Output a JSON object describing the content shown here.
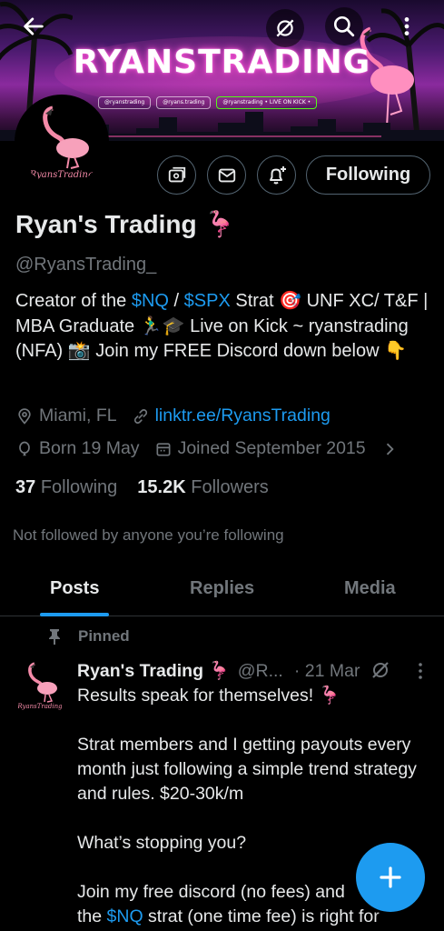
{
  "banner": {
    "brand_text": "RYANSTRADING",
    "socials": [
      "@ryanstrading",
      "@ryans.trading",
      "@ryanstrading • LIVE ON KICK •"
    ]
  },
  "profile": {
    "name": "Ryan's Trading",
    "name_emoji": "🦩",
    "handle": "@RyansTrading_",
    "bio": {
      "part1": "Creator of the ",
      "link1": "$NQ",
      "part2": " / ",
      "link2": "$SPX",
      "part3": " Strat 🎯 UNF XC/ T&F | MBA Graduate 🏃‍♂️🎓 Live on Kick ~ ryanstrading (NFA) 📸 Join my FREE Discord down below 👇"
    },
    "location": "Miami, FL",
    "website": "linktr.ee/RyansTrading",
    "born": "Born 19 May",
    "joined": "Joined September 2015",
    "following_count": "37",
    "following_label": "Following",
    "followers_count": "15.2K",
    "followers_label": "Followers",
    "followed_by": "Not followed by anyone you’re following"
  },
  "actions": {
    "following_button": "Following"
  },
  "tabs": [
    {
      "label": "Posts",
      "active": true
    },
    {
      "label": "Replies",
      "active": false
    },
    {
      "label": "Media",
      "active": false
    }
  ],
  "post": {
    "pinned_label": "Pinned",
    "author_name": "Ryan's Trading 🦩",
    "author_handle": "@R...",
    "time": "· 21 Mar",
    "line1": "Results speak for themselves! 🦩",
    "line2": "Strat members and I getting payouts every month just following a simple trend strategy and rules. $20-30k/m",
    "line3": "What’s stopping you?",
    "line4a": "Join my free discord (no fees) and",
    "line4b": "the ",
    "line4link": "$NQ",
    "line4c": " strat (one time fee) is right for"
  },
  "colors": {
    "accent": "#1d9bf0",
    "text": "#e7e9ea",
    "muted": "#71767b",
    "border": "#2f3336",
    "background": "#000000"
  },
  "icons": [
    "back-arrow-icon",
    "grok-icon",
    "search-icon",
    "more-vertical-icon",
    "subscribe-icon",
    "mail-icon",
    "bell-plus-icon",
    "location-icon",
    "link-icon",
    "balloon-icon",
    "calendar-icon",
    "chevron-right-icon",
    "pin-icon",
    "plus-icon"
  ]
}
